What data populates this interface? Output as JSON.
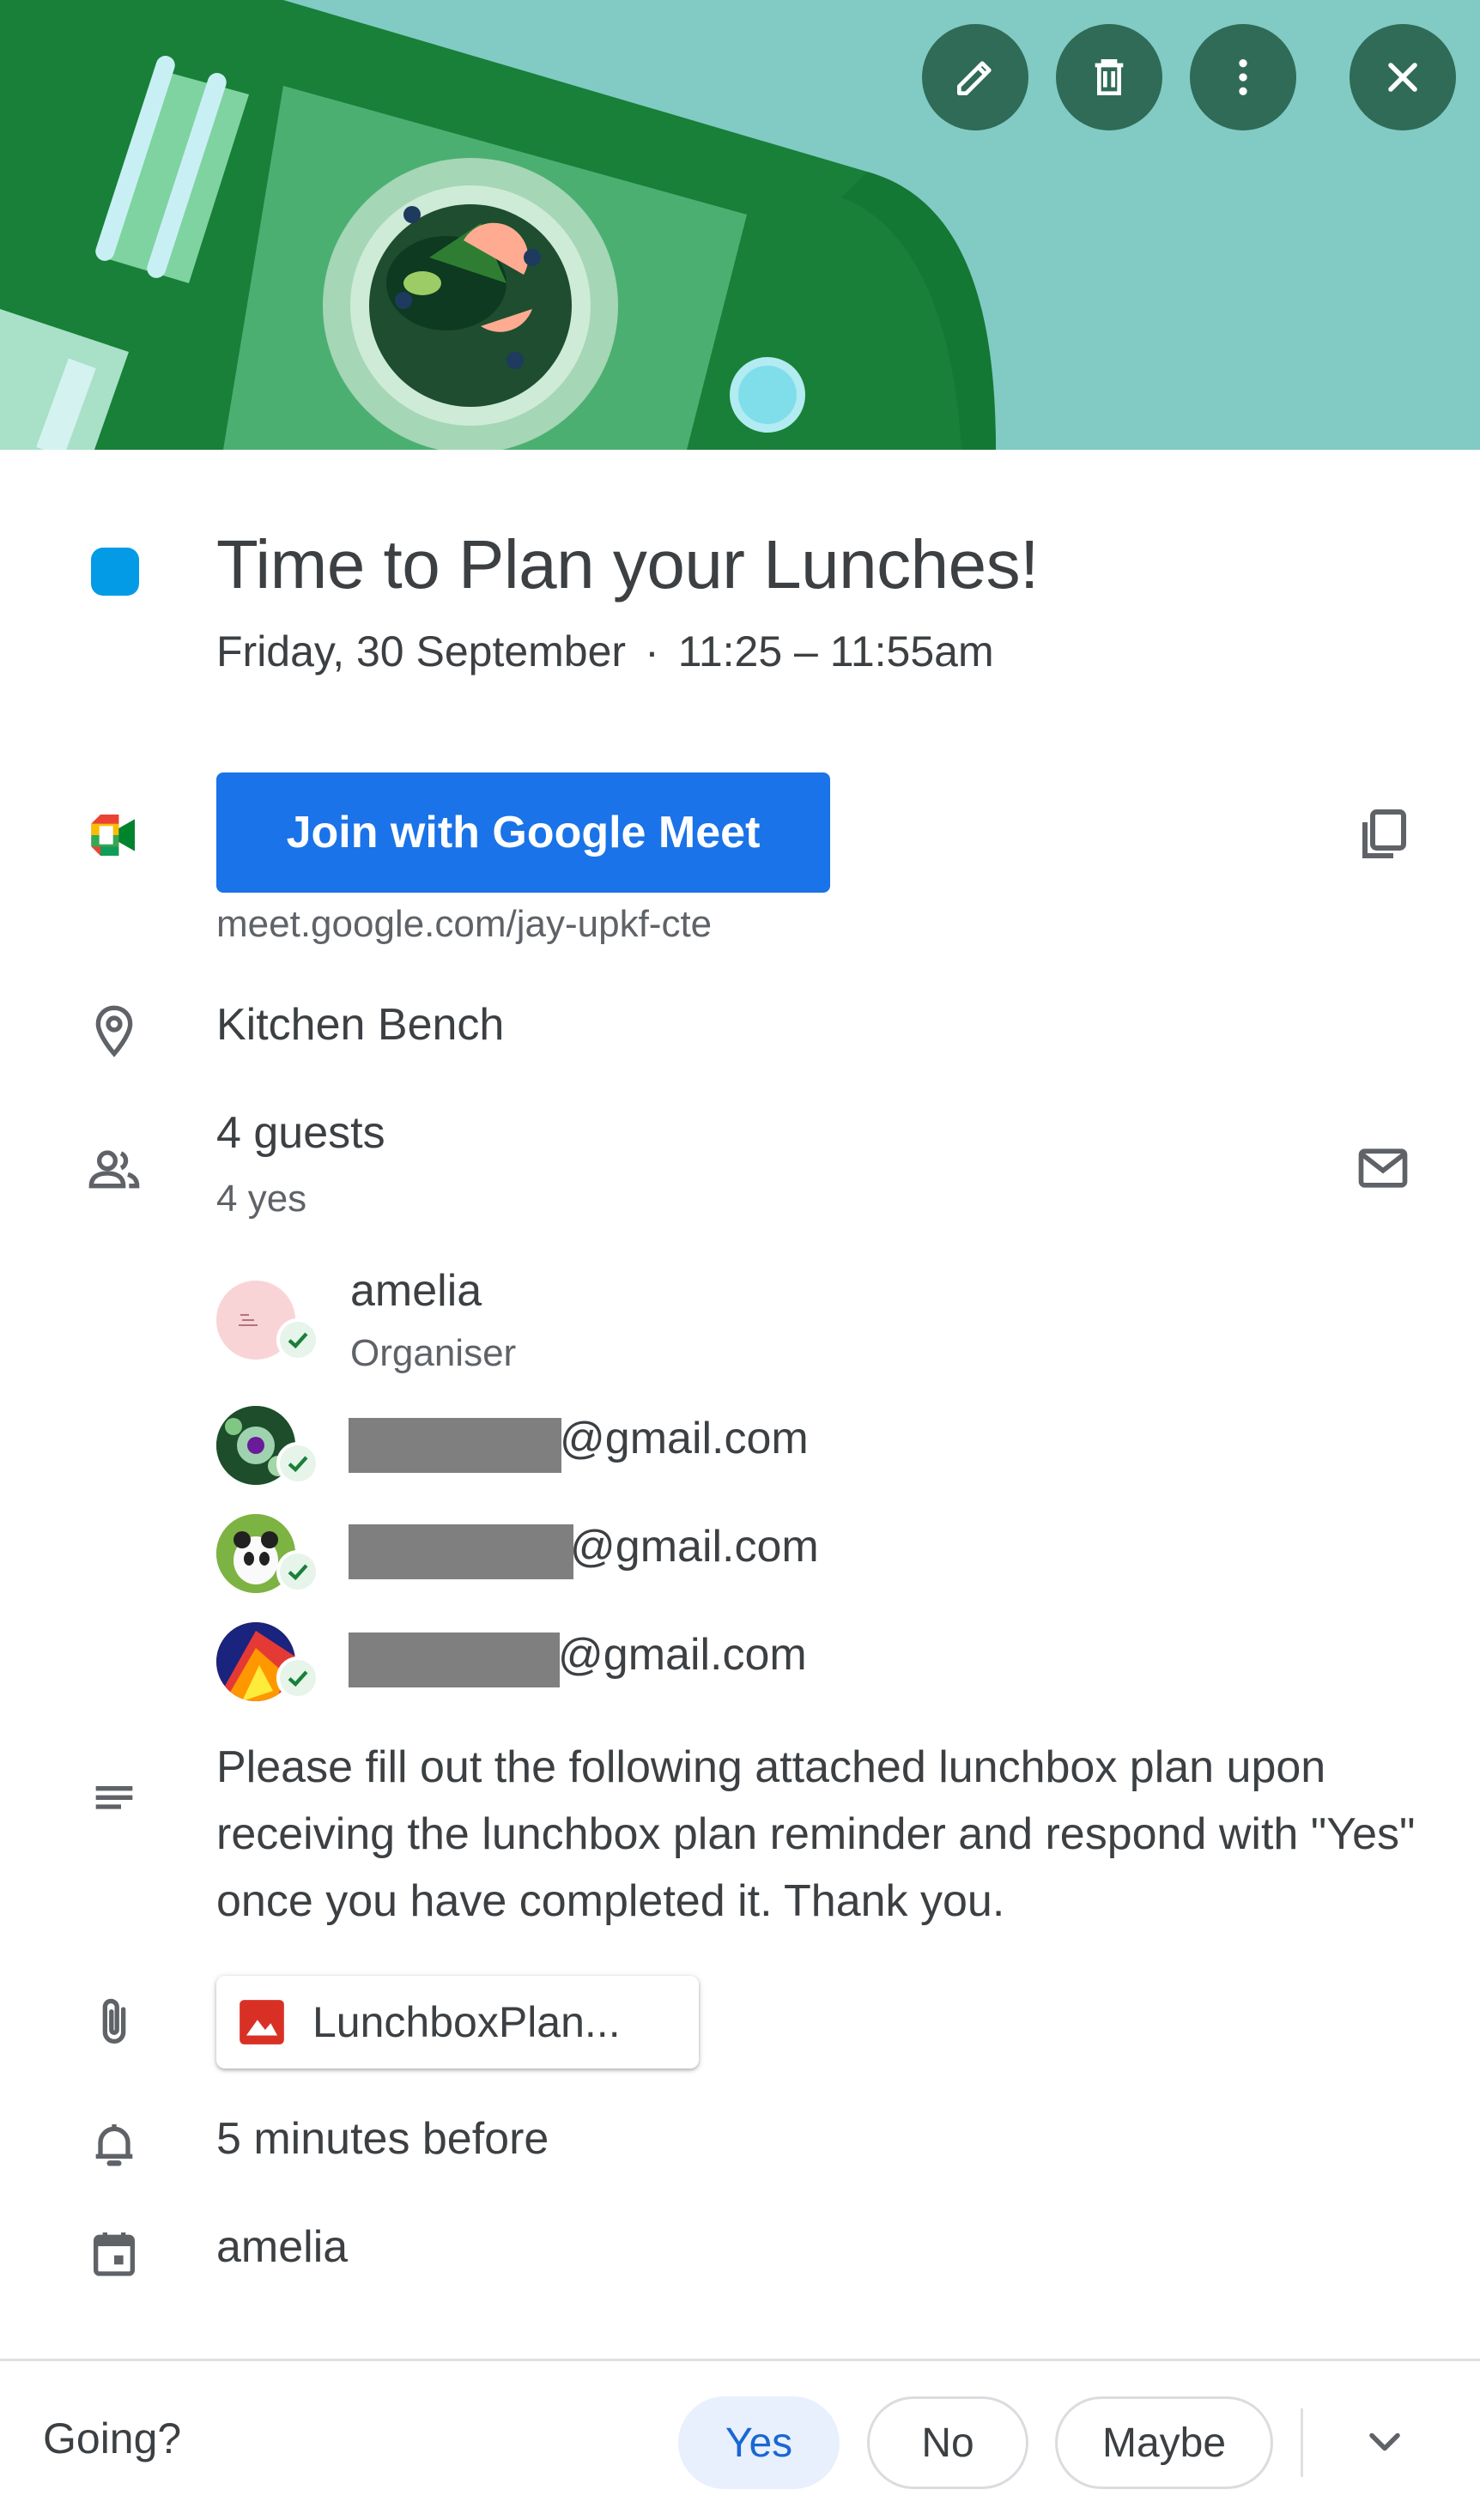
{
  "event": {
    "title": "Time to Plan your Lunches!",
    "date": "Friday, 30 September",
    "separator": "·",
    "time": "11:25 – 11:55am",
    "color": "#039be5"
  },
  "header_actions": {
    "edit_icon": "pencil-icon",
    "delete_icon": "trash-icon",
    "more_icon": "more-vert-icon",
    "close_icon": "close-icon"
  },
  "meet": {
    "join_label": "Join with Google Meet",
    "link": "meet.google.com/jay-upkf-cte",
    "accent": "#1a73e8"
  },
  "location": "Kitchen Bench",
  "guests": {
    "count_label": "4 guests",
    "yes_label": "4 yes",
    "list": [
      {
        "name": "amelia",
        "role": "Organiser"
      },
      {
        "name": "@gmail.com"
      },
      {
        "name": "@gmail.com"
      },
      {
        "name": "@gmail.com"
      }
    ]
  },
  "description": "Please fill out the following attached lunchbox plan upon receiving the lunchbox plan reminder and respond with \"Yes\" once you have completed it. Thank you.",
  "attachment": {
    "name": "LunchboxPlan..."
  },
  "reminder": "5 minutes before",
  "calendar_owner": "amelia",
  "rsvp": {
    "question": "Going?",
    "yes": "Yes",
    "no": "No",
    "maybe": "Maybe",
    "selected": "Yes"
  }
}
